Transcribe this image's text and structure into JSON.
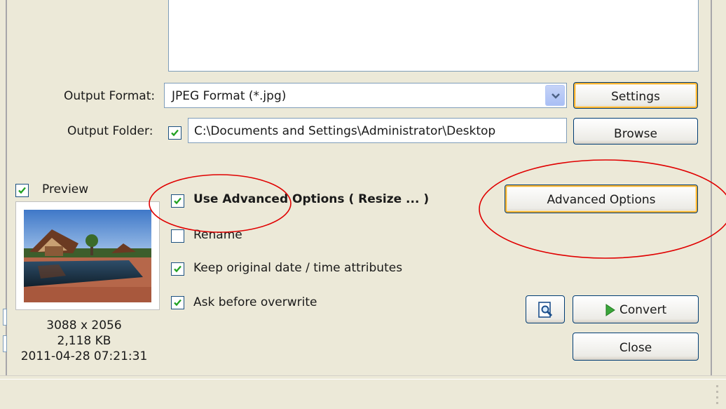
{
  "output": {
    "format_label": "Output Format:",
    "format_value": "JPEG Format (*.jpg)",
    "settings_button": "Settings",
    "folder_label": "Output Folder:",
    "folder_value": "C:\\Documents and Settings\\Administrator\\Desktop",
    "browse_button": "Browse",
    "folder_checked": true
  },
  "preview": {
    "label": "Preview",
    "checked": true,
    "dimensions": "3088 x 2056",
    "size": "2,118 KB",
    "datetime": "2011-04-28 07:21:31"
  },
  "options": {
    "advanced_label": "Use Advanced Options ( Resize ... )",
    "advanced_checked": true,
    "rename_label": "Rename",
    "rename_checked": false,
    "keep_date_label": "Keep original date / time attributes",
    "keep_date_checked": true,
    "ask_overwrite_label": "Ask before overwrite",
    "ask_overwrite_checked": true
  },
  "buttons": {
    "advanced_options": "Advanced Options",
    "convert": "Convert",
    "close": "Close"
  },
  "icons": {
    "preview_button": "magnifier-page-icon",
    "convert": "play-arrow-icon",
    "combo": "chevron-down-icon"
  },
  "annotation_color": "#e00000"
}
